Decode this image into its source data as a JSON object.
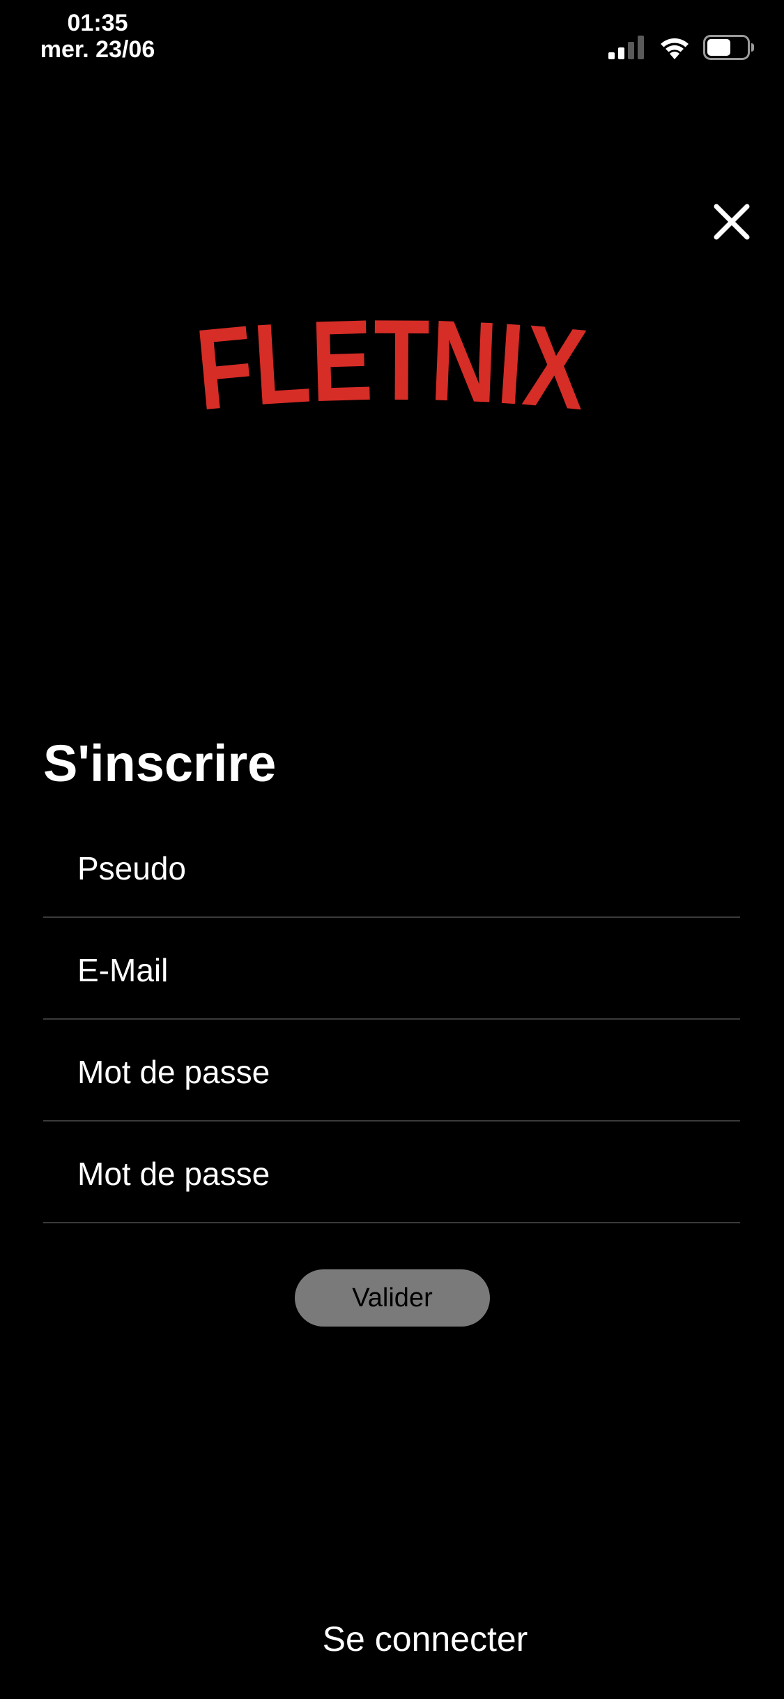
{
  "status_bar": {
    "time": "01:35",
    "date": "mer. 23/06",
    "signal_icon": "cellular-signal-icon",
    "wifi_icon": "wifi-icon",
    "battery_icon": "battery-icon",
    "battery_level": 0.6
  },
  "close_icon": "close-icon",
  "logo": {
    "text": "FLETNIX",
    "color": "#d62d27"
  },
  "signup": {
    "title": "S'inscrire",
    "fields": [
      {
        "placeholder": "Pseudo",
        "value": ""
      },
      {
        "placeholder": "E-Mail",
        "value": ""
      },
      {
        "placeholder": "Mot de passe",
        "value": ""
      },
      {
        "placeholder": "Mot de passe",
        "value": ""
      }
    ],
    "submit_label": "Valider"
  },
  "login_link": "Se connecter",
  "colors": {
    "background": "#000000",
    "text": "#ffffff",
    "divider": "#3a3a3a",
    "button_bg": "#7a7a7a"
  }
}
